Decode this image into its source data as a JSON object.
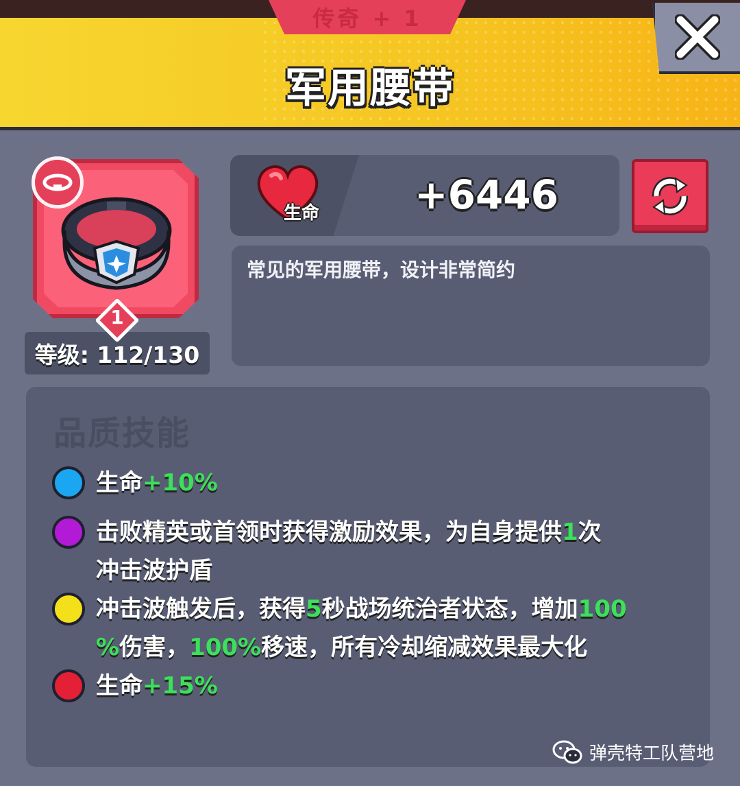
{
  "header": {
    "rarity": "传奇 + 1",
    "title": "军用腰带"
  },
  "item": {
    "level_badge": "1",
    "level_text": "等级: 112/130",
    "icon": "belt-icon",
    "type_icon": "belt-type-icon"
  },
  "stat": {
    "label": "生命",
    "value": "+6446",
    "icon": "heart-icon"
  },
  "description": "常见的军用腰带，设计非常简约",
  "skills": {
    "title": "品质技能",
    "items": [
      {
        "color": "#1aa6f0",
        "text": "生命",
        "bonus": "+10%"
      },
      {
        "color": "#b31ad6",
        "parts": [
          "击败精英或首领时获得激励效果，为自身提供",
          "1",
          "次"
        ],
        "line2": "冲击波护盾"
      },
      {
        "color": "#f4e01a",
        "parts": [
          "冲击波触发后，获得",
          "5",
          "秒战场统治者状态，增加",
          "100"
        ],
        "line2_parts": [
          "%",
          "伤害，",
          "100%",
          "移速，所有冷却缩减效果最大化"
        ]
      },
      {
        "color": "#e32035",
        "text": "生命",
        "bonus": "+15%"
      }
    ]
  },
  "watermark": "弹壳特工队营地",
  "colors": {
    "header_yellow": "#f7d630",
    "rarity_red": "#e5405a",
    "bonus_green": "#3ce05a",
    "panel_bg": "#6c7188"
  }
}
